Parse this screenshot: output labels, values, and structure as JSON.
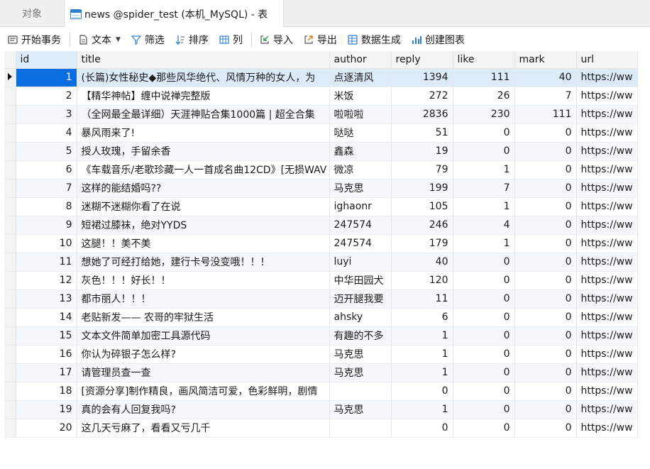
{
  "tabs": {
    "objects": "对象",
    "table_tab": "news @spider_test (本机_MySQL) - 表"
  },
  "toolbar": {
    "begin_transaction": "开始事务",
    "text": "文本",
    "filter": "筛选",
    "sort": "排序",
    "columns": "列",
    "import": "导入",
    "export": "导出",
    "data_generation": "数据生成",
    "create_chart": "创建图表"
  },
  "icons": {
    "begin_transaction": "transaction-icon",
    "text": "document-icon",
    "filter": "funnel-icon",
    "sort": "sort-icon",
    "columns": "grid-icon",
    "import": "import-icon",
    "export": "export-icon",
    "data_generation": "data-gen-icon",
    "create_chart": "chart-icon"
  },
  "colors": {
    "selected_cell": "#0b6ee0",
    "selected_row": "#dcebf9",
    "alt_row": "#f4f8fc"
  },
  "grid": {
    "columns": [
      "id",
      "title",
      "author",
      "reply",
      "like",
      "mark",
      "url"
    ],
    "current_row": 0,
    "rows": [
      {
        "id": "1",
        "title": "(长篇)女性秘史◆那些风华绝代、风情万种的女人，为",
        "author": "点逐清风",
        "reply": "1394",
        "like": "111",
        "mark": "40",
        "url": "https://ww"
      },
      {
        "id": "2",
        "title": "【精华神帖】缠中说禅完整版",
        "author": "米饭",
        "reply": "272",
        "like": "26",
        "mark": "7",
        "url": "https://ww"
      },
      {
        "id": "3",
        "title": "（全网最全最详细）天涯神贴合集1000篇 | 超全合集",
        "author": "啦啦啦",
        "reply": "2836",
        "like": "230",
        "mark": "111",
        "url": "https://ww"
      },
      {
        "id": "4",
        "title": "暴风雨来了!",
        "author": "哒哒",
        "reply": "51",
        "like": "0",
        "mark": "0",
        "url": "https://ww"
      },
      {
        "id": "5",
        "title": "授人玫瑰，手留余香",
        "author": "鑫森",
        "reply": "19",
        "like": "0",
        "mark": "0",
        "url": "https://ww"
      },
      {
        "id": "6",
        "title": "《车载音乐/老歌珍藏一人一首成名曲12CD》[无损WAV",
        "author": "微凉",
        "reply": "79",
        "like": "1",
        "mark": "0",
        "url": "https://ww"
      },
      {
        "id": "7",
        "title": "这样的能结婚吗??",
        "author": "马克思",
        "reply": "199",
        "like": "7",
        "mark": "0",
        "url": "https://ww"
      },
      {
        "id": "8",
        "title": "迷糊不迷糊你看了在说",
        "author": "ighaonr",
        "reply": "105",
        "like": "1",
        "mark": "0",
        "url": "https://ww"
      },
      {
        "id": "9",
        "title": "短裙过膝袜，绝对YYDS",
        "author": "247574",
        "reply": "246",
        "like": "4",
        "mark": "0",
        "url": "https://ww"
      },
      {
        "id": "10",
        "title": "这腿！！美不美",
        "author": "247574",
        "reply": "179",
        "like": "1",
        "mark": "0",
        "url": "https://ww"
      },
      {
        "id": "11",
        "title": "想她了可经打给她，建行卡号没变哦！！！",
        "author": "luyi",
        "reply": "40",
        "like": "0",
        "mark": "0",
        "url": "https://ww"
      },
      {
        "id": "12",
        "title": "灰色！！！好长！！",
        "author": "中华田园犬",
        "reply": "120",
        "like": "0",
        "mark": "0",
        "url": "https://ww"
      },
      {
        "id": "13",
        "title": "都市丽人！！！",
        "author": "迈开腿我要",
        "reply": "11",
        "like": "0",
        "mark": "0",
        "url": "https://ww"
      },
      {
        "id": "14",
        "title": "老贴新发—— 农哥的牢狱生活",
        "author": "ahsky",
        "reply": "6",
        "like": "0",
        "mark": "0",
        "url": "https://ww"
      },
      {
        "id": "15",
        "title": "文本文件简单加密工具源代码",
        "author": "有趣的不多",
        "reply": "1",
        "like": "0",
        "mark": "0",
        "url": "https://ww"
      },
      {
        "id": "16",
        "title": "你认为碎银子怎么样?",
        "author": "马克思",
        "reply": "1",
        "like": "0",
        "mark": "0",
        "url": "https://ww"
      },
      {
        "id": "17",
        "title": "请管理员查一查",
        "author": "马克思",
        "reply": "1",
        "like": "0",
        "mark": "0",
        "url": "https://ww"
      },
      {
        "id": "18",
        "title": "[资源分享]制作精良，画风简洁可爱，色彩鲜明，剧情",
        "author": "",
        "reply": "0",
        "like": "0",
        "mark": "0",
        "url": "https://ww"
      },
      {
        "id": "19",
        "title": "真的会有人回复我吗?",
        "author": "马克思",
        "reply": "1",
        "like": "0",
        "mark": "0",
        "url": "https://ww"
      },
      {
        "id": "20",
        "title": "这几天亏麻了，看看又亏几千",
        "author": "",
        "reply": "0",
        "like": "0",
        "mark": "0",
        "url": "https://ww"
      }
    ]
  }
}
